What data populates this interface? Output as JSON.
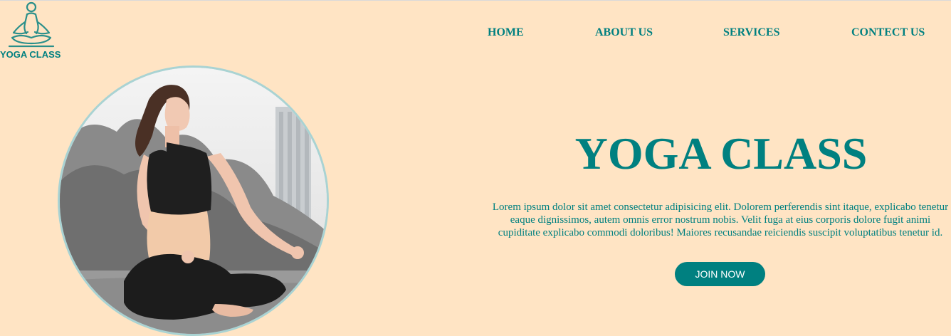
{
  "logo": {
    "text": "YOGA CLASS",
    "icon": "meditation-figure-icon"
  },
  "nav": {
    "items": [
      {
        "label": "HOME"
      },
      {
        "label": "ABOUT US"
      },
      {
        "label": "SERVICES"
      },
      {
        "label": "CONTECT US"
      }
    ]
  },
  "hero": {
    "image": "woman-meditating-photo",
    "title": "YOGA CLASS",
    "text": "Lorem ipsum dolor sit amet consectetur adipisicing elit. Dolorem perferendis sint itaque, explicabo tenetur eaque dignissimos, autem omnis error nostrum nobis. Velit fuga at eius corporis dolore fugit animi cupiditate explicabo commodi doloribus! Maiores recusandae reiciendis suscipit voluptatibus tenetur id.",
    "button_label": "JOIN NOW"
  },
  "colors": {
    "background": "#ffe4c4",
    "accent": "#008080",
    "button_text": "#ffffff",
    "photo_border": "#a9d3d3"
  }
}
